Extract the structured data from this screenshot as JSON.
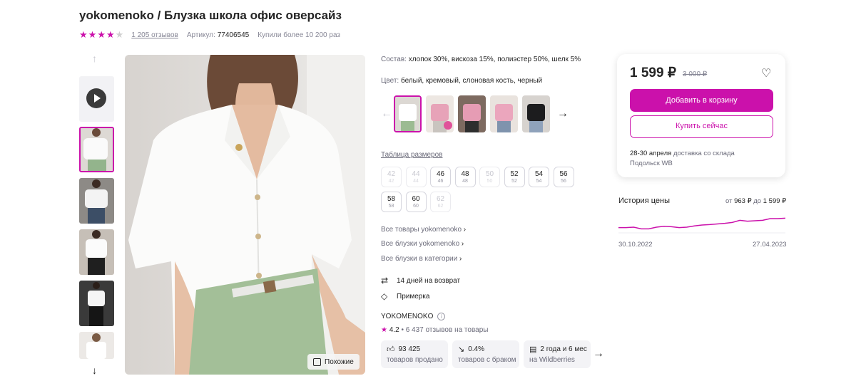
{
  "product": {
    "title": "yokomenoko / Блузка школа офис оверсайз",
    "rating_stars": 4,
    "reviews": "1 205 отзывов",
    "article_label": "Артикул:",
    "article": "77406545",
    "bought": "Купили более 10 200 раз"
  },
  "gallery": {
    "similar_button": "Похожие"
  },
  "details": {
    "composition_label": "Состав:",
    "composition": "хлопок 30%, вискоза 15%, полиэстер 50%, шелк 5%",
    "color_label": "Цвет:",
    "colors": "белый, кремовый, слоновая кость, черный",
    "size_table_link": "Таблица размеров",
    "sizes": [
      {
        "ru": "42",
        "eu": "42",
        "available": false
      },
      {
        "ru": "44",
        "eu": "44",
        "available": false
      },
      {
        "ru": "46",
        "eu": "46",
        "available": true
      },
      {
        "ru": "48",
        "eu": "48",
        "available": true
      },
      {
        "ru": "50",
        "eu": "50",
        "available": false
      },
      {
        "ru": "52",
        "eu": "52",
        "available": true
      },
      {
        "ru": "54",
        "eu": "54",
        "available": true
      },
      {
        "ru": "56",
        "eu": "56",
        "available": true
      },
      {
        "ru": "58",
        "eu": "58",
        "available": true
      },
      {
        "ru": "60",
        "eu": "60",
        "available": true
      },
      {
        "ru": "62",
        "eu": "62",
        "available": false
      }
    ],
    "links": [
      "Все товары yokomenoko",
      "Все блузки yokomenoko",
      "Все блузки в категории"
    ],
    "return_days": "14 дней на возврат",
    "fitting": "Примерка",
    "brand": "YOKOMENOKO",
    "brand_rating": "4.2",
    "brand_reviews": "6 437 отзывов на товары",
    "stats": [
      {
        "value": "93 425",
        "label": "товаров продано",
        "icon": "thumbs-up-icon"
      },
      {
        "value": "0.4%",
        "label": "товаров с браком",
        "icon": "trend-down-icon"
      },
      {
        "value": "2 года и 6 мес",
        "label": "на Wildberries",
        "icon": "calendar-icon"
      }
    ]
  },
  "buy_card": {
    "price": "1 599 ₽",
    "old_price": "3 000 ₽",
    "add_to_cart": "Добавить в корзину",
    "buy_now": "Купить сейчас",
    "delivery_date": "28-30 апреля",
    "delivery_text": " доставка со склада",
    "warehouse": "Подольск WB"
  },
  "price_history": {
    "title": "История цены",
    "range_from": "от ",
    "min": "963 ₽",
    "range_to": " до ",
    "max": "1 599 ₽",
    "date_start": "30.10.2022",
    "date_end": "27.04.2023",
    "series": [
      0.72,
      0.72,
      0.7,
      0.78,
      0.78,
      0.7,
      0.66,
      0.68,
      0.72,
      0.7,
      0.64,
      0.6,
      0.58,
      0.55,
      0.52,
      0.48,
      0.38,
      0.42,
      0.4,
      0.38,
      0.3,
      0.3,
      0.28
    ],
    "color": "#cb11ab"
  }
}
